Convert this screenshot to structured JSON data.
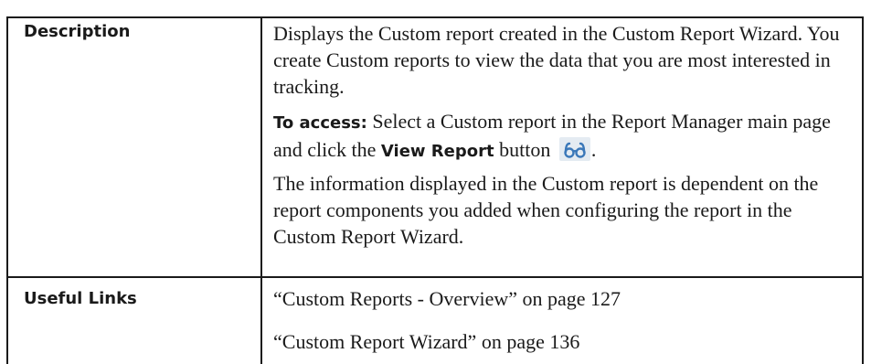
{
  "table": {
    "description_label": "Description",
    "description_p1": "Displays the Custom report created in the Custom Report Wizard. You create Custom reports to view the data that you are most interested in tracking.",
    "access_label": "To access:",
    "access_text_1": " Select a Custom report in the Report Manager main page and click the ",
    "view_report_label": "View Report",
    "access_text_2": " button ",
    "access_text_3": ".",
    "description_p3": "The information displayed in the Custom report is dependent on the report components you added when configuring the report in the Custom Report Wizard.",
    "links_label": "Useful Links",
    "links": [
      "“Custom Reports - Overview” on page 127",
      "“Custom Report Wizard” on page 136"
    ]
  },
  "icons": {
    "view_report": "glasses-icon"
  },
  "colors": {
    "border": "#1a1a1a",
    "icon_blue": "#3b78b9"
  }
}
